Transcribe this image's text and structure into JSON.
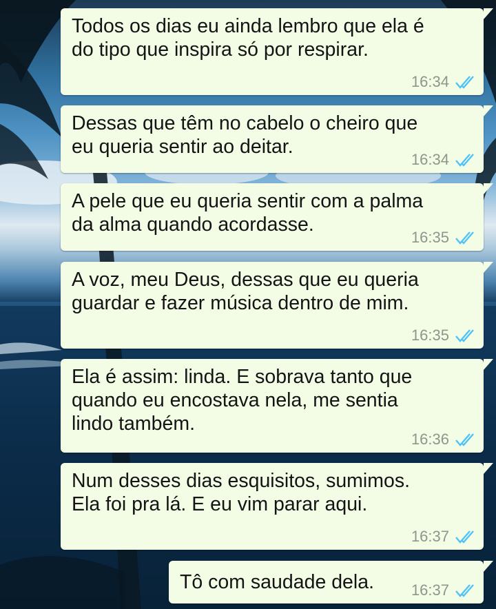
{
  "messages": [
    {
      "text": "Todos os dias eu ainda lembro que ela é\ndo tipo que inspira só por respirar.",
      "time": "16:34"
    },
    {
      "text": "Dessas que têm no cabelo o cheiro que\neu queria sentir ao deitar.",
      "time": "16:34"
    },
    {
      "text": "A pele que eu queria sentir com a palma\nda alma quando acordasse.",
      "time": "16:35"
    },
    {
      "text": "A voz, meu Deus, dessas que eu queria\nguardar e fazer música dentro de mim.",
      "time": "16:35"
    },
    {
      "text": "Ela é assim: linda. E sobrava tanto que\nquando eu encostava nela, me sentia\nlindo também.",
      "time": "16:36"
    },
    {
      "text": "Num desses dias esquisitos, sumimos.\nEla foi pra lá. E eu vim parar aqui.",
      "time": "16:37"
    },
    {
      "text": "Tô com saudade dela.",
      "time": "16:37"
    }
  ],
  "colors": {
    "bubble": "#f3fde6",
    "read_tick": "#4fc3f7",
    "time": "#8c968a"
  },
  "icons": {
    "status": "double-check-icon"
  }
}
